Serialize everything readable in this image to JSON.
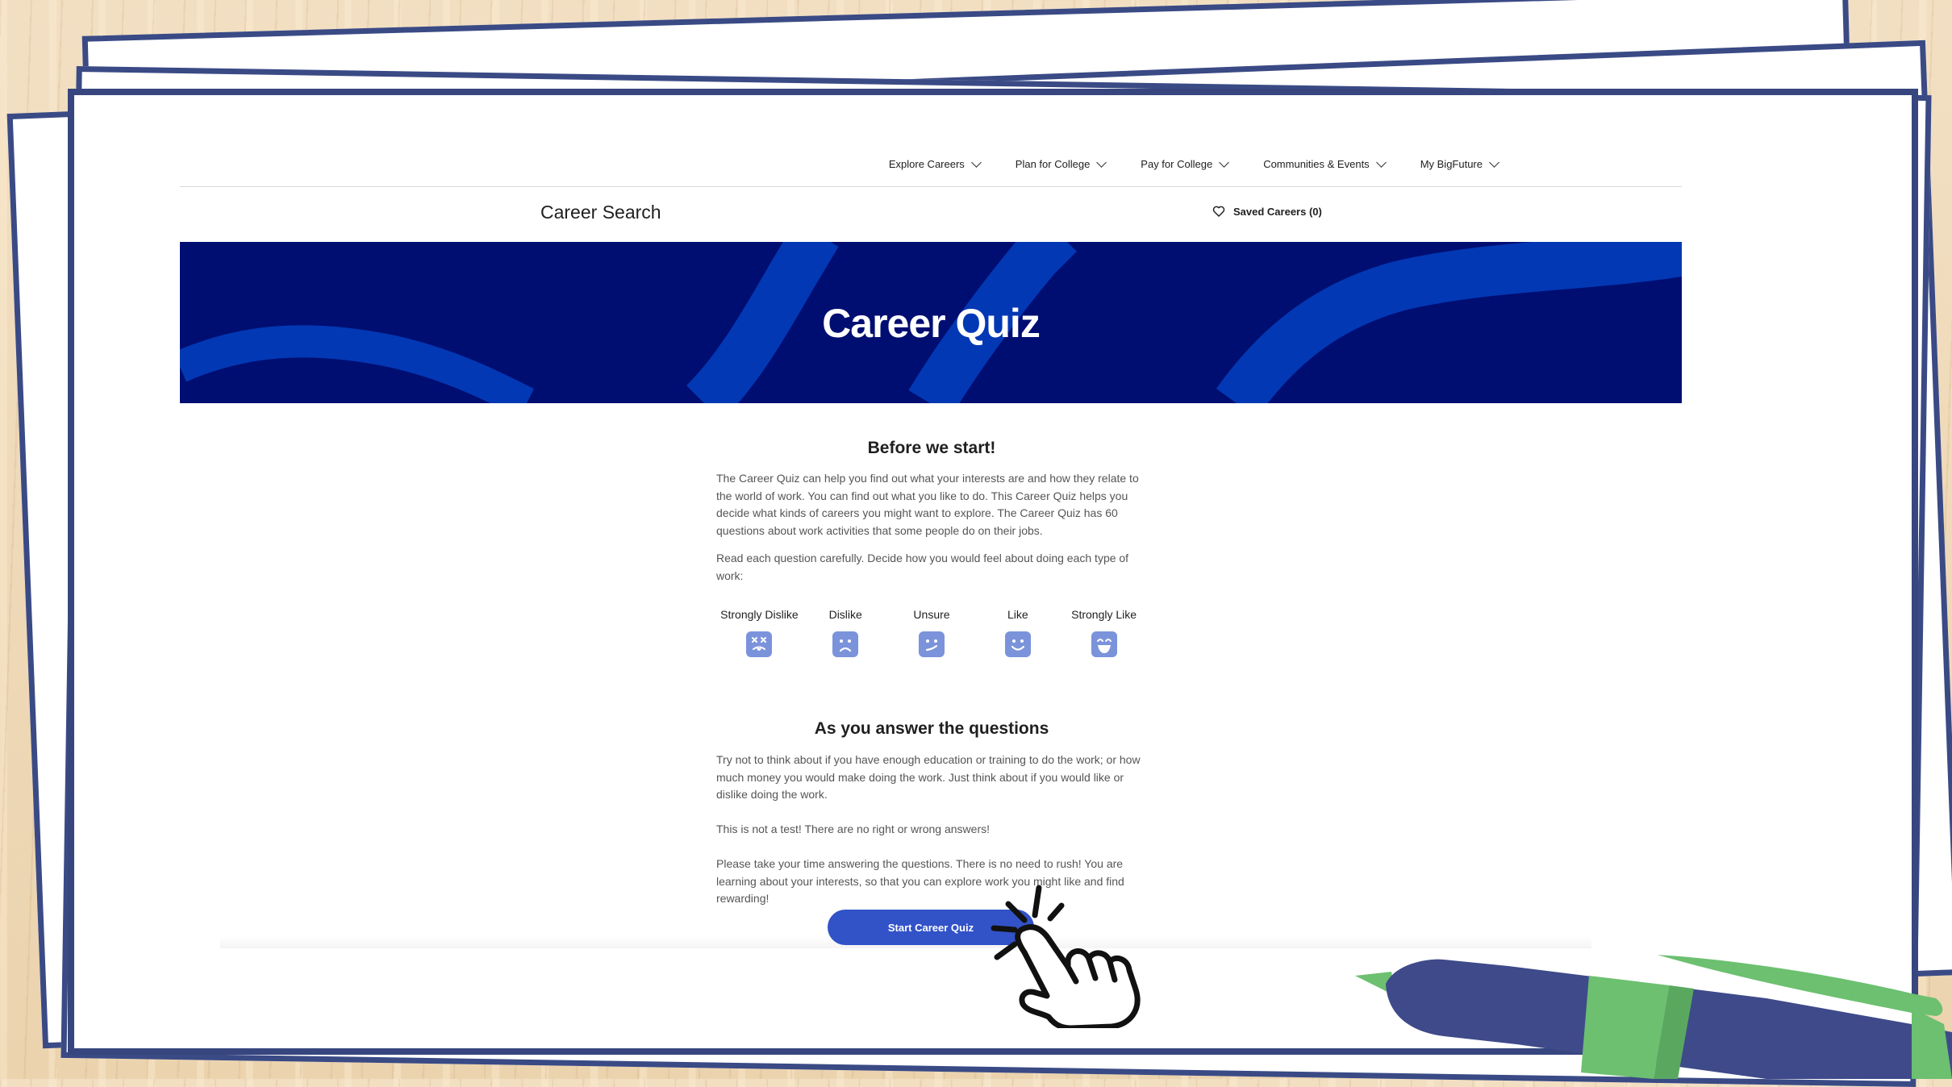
{
  "nav": {
    "items": [
      {
        "label": "Explore Careers"
      },
      {
        "label": "Plan for College"
      },
      {
        "label": "Pay for College"
      },
      {
        "label": "Communities & Events"
      },
      {
        "label": "My BigFuture"
      }
    ]
  },
  "header": {
    "title": "Career Search",
    "saved_careers": "Saved Careers (0)"
  },
  "banner": {
    "title": "Career Quiz"
  },
  "intro": {
    "heading": "Before we start!",
    "paragraph1": "The Career Quiz can help you find out what your interests are and how they relate to the world of work. You can find out what you like to do. This Career Quiz helps you decide what kinds of careers you might want to explore. The Career Quiz has 60 questions about work activities that some people do on their jobs.",
    "paragraph2": "Read each question carefully. Decide how you would feel about doing each type of work:"
  },
  "scale": [
    {
      "label": "Strongly Dislike",
      "icon": "strongly-dislike-face-icon"
    },
    {
      "label": "Dislike",
      "icon": "dislike-face-icon"
    },
    {
      "label": "Unsure",
      "icon": "unsure-face-icon"
    },
    {
      "label": "Like",
      "icon": "like-face-icon"
    },
    {
      "label": "Strongly Like",
      "icon": "strongly-like-face-icon"
    }
  ],
  "answer": {
    "heading": "As you answer the questions",
    "paragraph1": "Try not to think about if you have enough education or training to do the work; or how much money you would make doing the work. Just think about if you would like or dislike doing the work.",
    "paragraph2": "This is not a test! There are no right or wrong answers!",
    "paragraph3": "Please take your time answering the questions. There is no need to rush! You are learning about your interests, so that you can explore work you might like and find rewarding!"
  },
  "cta": {
    "label": "Start Career Quiz"
  },
  "colors": {
    "navy": "#000e72",
    "banner_stripe": "#0338b4",
    "button": "#3252c8",
    "face": "#7b93db",
    "frame": "#37467f",
    "pen_green": "#6cc070"
  }
}
